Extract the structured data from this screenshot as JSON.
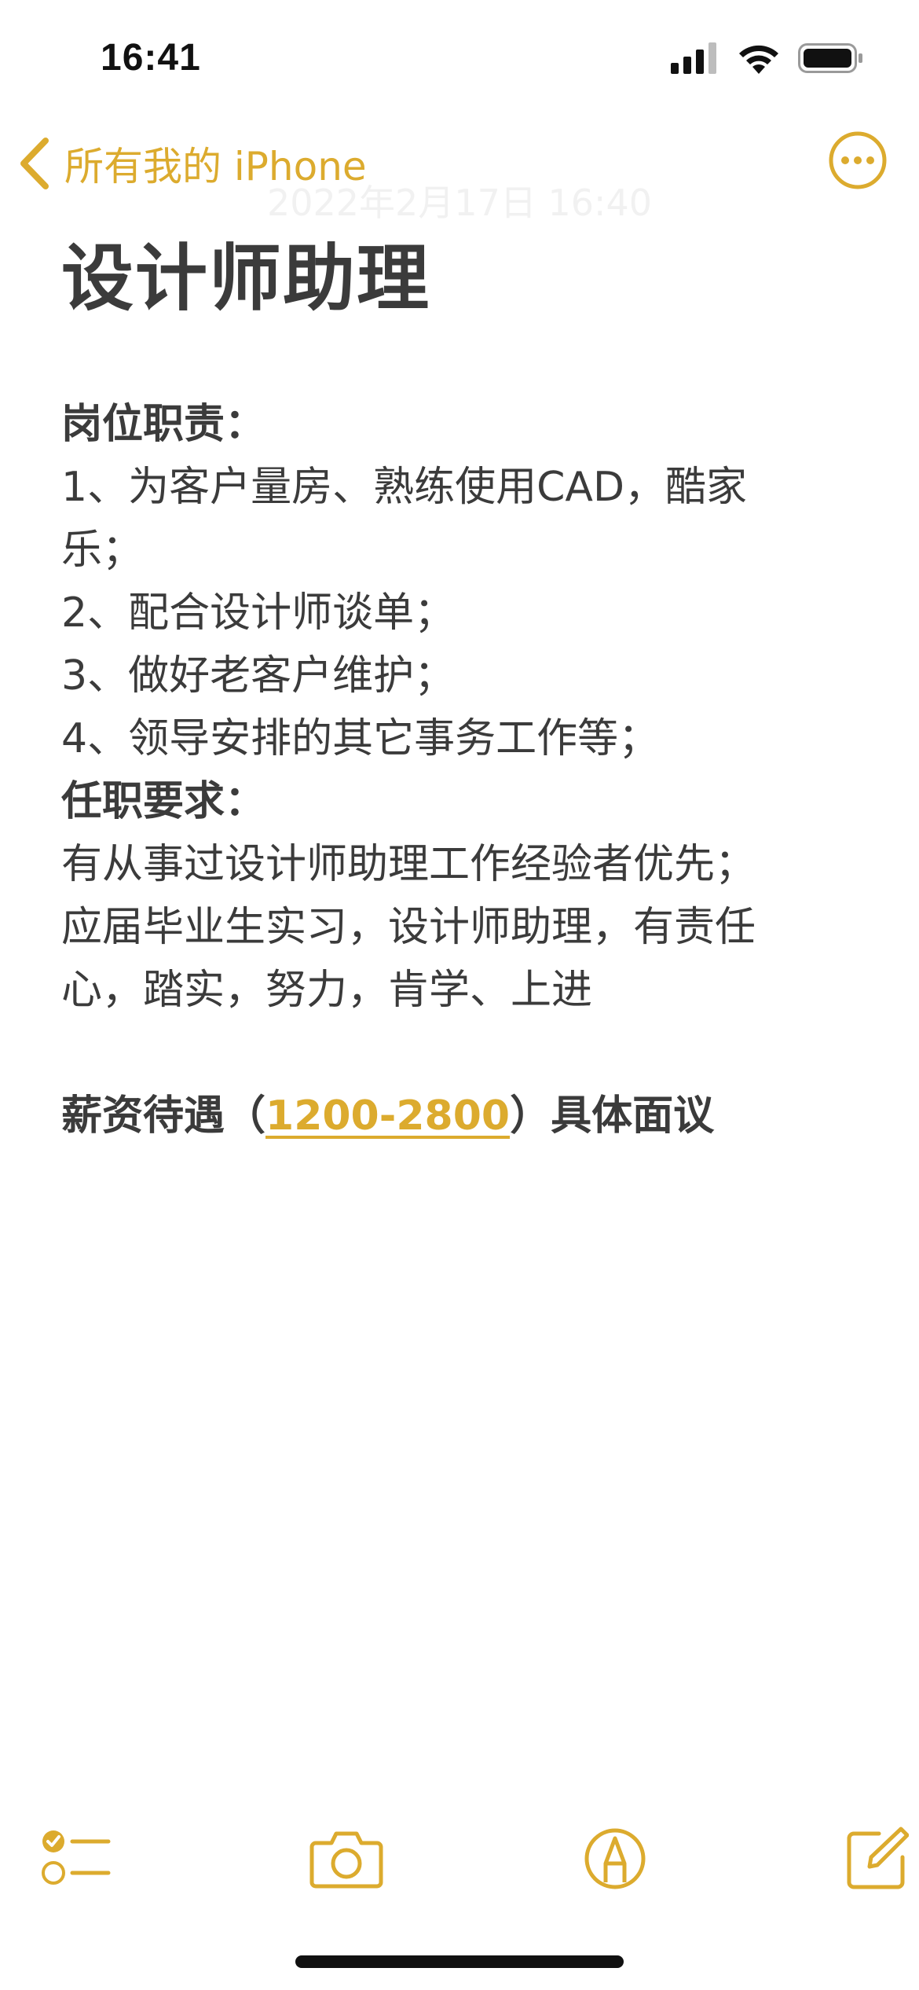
{
  "status_bar": {
    "time": "16:41"
  },
  "nav": {
    "back_label": "所有我的 iPhone",
    "timestamp": "2022年2月17日 16:40"
  },
  "note": {
    "title": "设计师助理",
    "lines": [
      "岗位职责：",
      "1、为客户量房、熟练使用CAD，酷家",
      "乐；",
      "2、配合设计师谈单；",
      "3、做好老客户维护；",
      "4、领导安排的其它事务工作等；",
      "任职要求：",
      "有从事过设计师助理工作经验者优先；",
      "应届毕业生实习，设计师助理，有责任",
      "心，踏实，努力，肯学、上进"
    ],
    "salary_prefix": "薪资待遇（",
    "salary_range": "1200-2800",
    "salary_suffix": "）具体面议"
  },
  "colors": {
    "accent": "#dcab2e",
    "text": "#3b3b3b"
  },
  "icons": {
    "back": "chevron-left-icon",
    "more": "ellipsis-circle-icon",
    "checklist": "checklist-icon",
    "camera": "camera-icon",
    "markup": "markup-pen-icon",
    "compose": "compose-icon"
  }
}
